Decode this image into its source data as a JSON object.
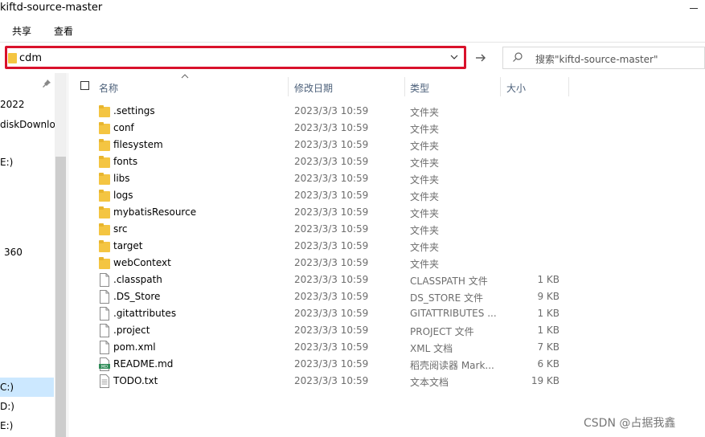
{
  "window": {
    "title": "kiftd-source-master"
  },
  "ribbon": {
    "tabs": [
      "共享",
      "查看"
    ]
  },
  "address": {
    "value": "cdm"
  },
  "search": {
    "placeholder": "搜索\"kiftd-source-master\""
  },
  "nav": {
    "items": [
      "2022",
      "diskDownlo",
      "E:)",
      "360",
      "C:)",
      "D:)",
      "E:)"
    ]
  },
  "columns": {
    "name": "名称",
    "date": "修改日期",
    "type": "类型",
    "size": "大小"
  },
  "files": [
    {
      "name": ".settings",
      "date": "2023/3/3 10:59",
      "type": "文件夹",
      "size": "",
      "icon": "folder-icon"
    },
    {
      "name": "conf",
      "date": "2023/3/3 10:59",
      "type": "文件夹",
      "size": "",
      "icon": "folder-icon"
    },
    {
      "name": "filesystem",
      "date": "2023/3/3 10:59",
      "type": "文件夹",
      "size": "",
      "icon": "folder-icon"
    },
    {
      "name": "fonts",
      "date": "2023/3/3 10:59",
      "type": "文件夹",
      "size": "",
      "icon": "folder-icon"
    },
    {
      "name": "libs",
      "date": "2023/3/3 10:59",
      "type": "文件夹",
      "size": "",
      "icon": "folder-icon"
    },
    {
      "name": "logs",
      "date": "2023/3/3 10:59",
      "type": "文件夹",
      "size": "",
      "icon": "folder-icon"
    },
    {
      "name": "mybatisResource",
      "date": "2023/3/3 10:59",
      "type": "文件夹",
      "size": "",
      "icon": "folder-icon"
    },
    {
      "name": "src",
      "date": "2023/3/3 10:59",
      "type": "文件夹",
      "size": "",
      "icon": "folder-icon"
    },
    {
      "name": "target",
      "date": "2023/3/3 10:59",
      "type": "文件夹",
      "size": "",
      "icon": "folder-icon"
    },
    {
      "name": "webContext",
      "date": "2023/3/3 10:59",
      "type": "文件夹",
      "size": "",
      "icon": "folder-icon"
    },
    {
      "name": ".classpath",
      "date": "2023/3/3 10:59",
      "type": "CLASSPATH 文件",
      "size": "1 KB",
      "icon": "file-icon"
    },
    {
      "name": ".DS_Store",
      "date": "2023/3/3 10:59",
      "type": "DS_STORE 文件",
      "size": "9 KB",
      "icon": "file-icon"
    },
    {
      "name": ".gitattributes",
      "date": "2023/3/3 10:59",
      "type": "GITATTRIBUTES ...",
      "size": "1 KB",
      "icon": "file-icon"
    },
    {
      "name": ".project",
      "date": "2023/3/3 10:59",
      "type": "PROJECT 文件",
      "size": "1 KB",
      "icon": "file-icon"
    },
    {
      "name": "pom.xml",
      "date": "2023/3/3 10:59",
      "type": "XML 文档",
      "size": "7 KB",
      "icon": "file-icon"
    },
    {
      "name": "README.md",
      "date": "2023/3/3 10:59",
      "type": "稻壳阅读器 Mark...",
      "size": "6 KB",
      "icon": "markdown-icon"
    },
    {
      "name": "TODO.txt",
      "date": "2023/3/3 10:59",
      "type": "文本文档",
      "size": "19 KB",
      "icon": "text-file-icon"
    }
  ],
  "watermark": "CSDN @占据我鑫",
  "colors": {
    "highlight_border": "#d9112b",
    "folder": "#f4c542",
    "selection": "#cce8ff"
  }
}
